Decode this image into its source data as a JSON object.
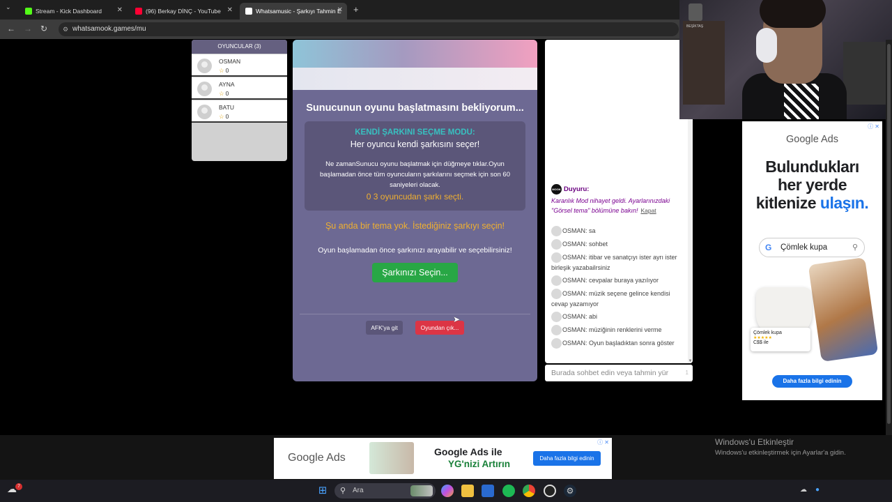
{
  "browser": {
    "tabs": [
      {
        "label": "Stream - Kick Dashboard",
        "favicon_color": "#53fc18"
      },
      {
        "label": "(96) Berkay DİNÇ - YouTube",
        "favicon_color": "#ff0033"
      },
      {
        "label": "Whatsamusic - Şarkıyı Tahmin E",
        "favicon_color": "#ffffff"
      }
    ],
    "active_tab_index": 2,
    "url": "whatsamook.games/mu"
  },
  "players": {
    "header": "OYUNCULAR (3)",
    "list": [
      {
        "name": "OSMAN",
        "score": "0"
      },
      {
        "name": "AYNA",
        "score": "0"
      },
      {
        "name": "BATU",
        "score": "0"
      }
    ]
  },
  "game": {
    "waiting_title": "Sunucunun oyunu başlatmasını bekliyorum...",
    "mode_title": "KENDİ ŞARKINI SEÇME MODU:",
    "mode_subtitle": "Her oyuncu kendi şarkısını seçer!",
    "mode_description": "Ne zamanSunucu oyunu başlatmak için düğmeye tıklar.Oyun başlamadan önce tüm oyuncuların şarkılarını seçmek için son 60 saniyeleri olacak.",
    "selection_status": "0 3 oyuncudan şarkı seçti.",
    "no_theme": "Şu anda bir tema yok. İstediğiniz şarkıyı seçin!",
    "search_note": "Oyun başlamadan önce şarkınızı arayabilir ve seçebilirsiniz!",
    "pick_button": "Şarkınızı Seçin...",
    "afk_button": "AFK'ya git",
    "leave_button": "Oyundan çık..."
  },
  "chat": {
    "announcement": {
      "title": "Duyuru:",
      "body": "Karanlık Mod nihayet geldi. Ayarlarınızdaki \"Görsel tema\" bölümüne bakın!",
      "close_label": "Kapat",
      "logo_text": "MOOK"
    },
    "messages": [
      "OSMAN: sa",
      "OSMAN: sohbet",
      "OSMAN: itibar ve sanatçıyı ister ayrı ister birleşik yazabailrsiniz",
      "OSMAN: cevpalar buraya yazılıyor",
      "OSMAN: müzik seçene gelince kendisi cevap yazamıyor",
      "OSMAN: abi",
      "OSMAN: müziğinin renklerini verme",
      "OSMAN: Oyun başladıktan sonra göster"
    ],
    "input_placeholder": "Burada sohbet edin veya tahmin yür",
    "input_counter": "1"
  },
  "ad_right": {
    "logo": "Google Ads",
    "headline_1": "Bulundukları",
    "headline_2": "her yerde",
    "headline_3": "kitlenize",
    "headline_accent": "ulaşın.",
    "search_text": "Çömlek kupa",
    "card_title": "Çömlek kupa",
    "card_price": "C$$ ile",
    "cta": "Daha fazla bilgi edinin",
    "accent_color": "#1a73e8"
  },
  "ad_bottom": {
    "logo": "Google Ads",
    "title_line_1": "Google Ads ile",
    "title_line_2": "YG'nizi Artırın",
    "cta": "Daha fazla bilgi edinin",
    "accent_color": "#188038"
  },
  "windows_activation": {
    "title": "Windows'u Etkinleştir",
    "subtitle": "Windows'u etkinleştirmek için Ayarlar'a gidin."
  },
  "taskbar": {
    "search_placeholder": "Ara",
    "weather_badge": "7",
    "apps": [
      "windows-start",
      "search",
      "copilot",
      "file-explorer",
      "microsoft-store",
      "spotify",
      "chrome",
      "obs",
      "steam"
    ]
  },
  "webcam": {
    "label": "BEŞİKTAŞ"
  }
}
